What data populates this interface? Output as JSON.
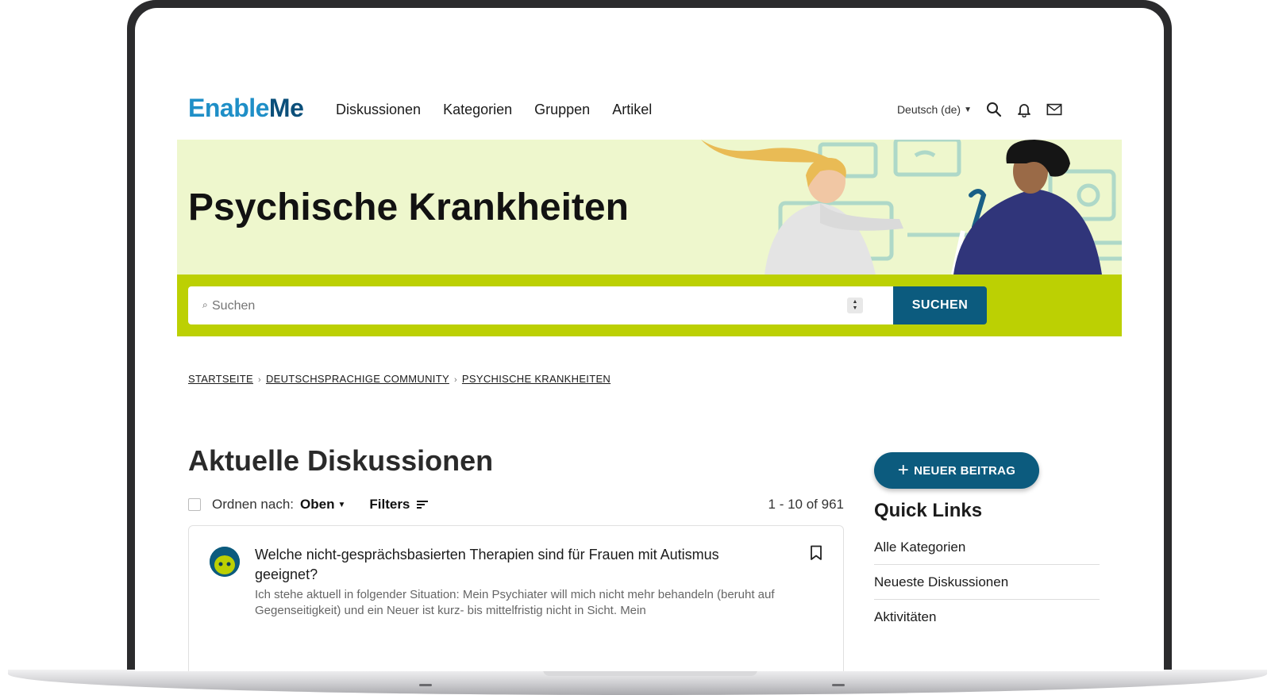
{
  "logo": {
    "part1": "Ena",
    "part2": "ble",
    "part3": "Me"
  },
  "nav": {
    "links": [
      "Diskussionen",
      "Kategorien",
      "Gruppen",
      "Artikel"
    ],
    "language": "Deutsch (de)"
  },
  "hero": {
    "title": "Psychische Krankheiten"
  },
  "search": {
    "glyph": "⌕",
    "placeholder": "Suchen",
    "button_label": "SUCHEN"
  },
  "breadcrumb": [
    "STARTSEITE",
    "DEUTSCHSPRACHIGE COMMUNITY",
    "PSYCHISCHE KRANKHEITEN"
  ],
  "discussions": {
    "title": "Aktuelle Diskussionen",
    "sort_label": "Ordnen nach:",
    "sort_value": "Oben",
    "filters_label": "Filters",
    "count": "1 - 10 of 961",
    "items": [
      {
        "title": "Welche nicht-gesprächsbasierten Therapien sind für Frauen mit Autismus geeignet?",
        "excerpt": "Ich stehe aktuell in folgender Situation: Mein Psychiater will mich nicht mehr behandeln (beruht auf Gegenseitigkeit) und ein Neuer ist kurz- bis mittelfristig nicht in Sicht. Mein"
      }
    ]
  },
  "sidebar": {
    "new_post": {
      "plus": "+",
      "label": "NEUER BEITRAG"
    },
    "quick_links_title": "Quick Links",
    "quick_links": [
      "Alle Kategorien",
      "Neueste Diskussionen",
      "Aktivitäten"
    ]
  },
  "colors": {
    "brand_light_blue": "#1f8fc7",
    "brand_dark_blue": "#0c5b7e",
    "hero_bg": "#eef7cd",
    "search_band": "#bcd003"
  }
}
